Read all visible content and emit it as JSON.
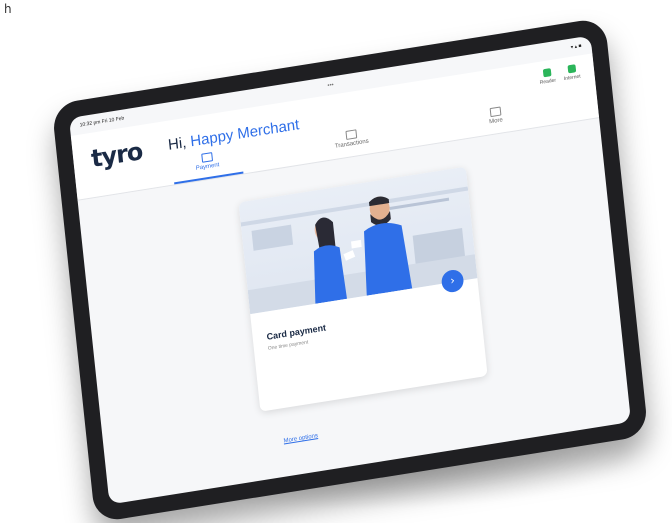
{
  "corner": {
    "text": "h"
  },
  "device": {
    "status_left": "10:32 pm  Fri 10 Feb",
    "status_right": "▾ ▴ ■"
  },
  "app": {
    "logo": "tyro",
    "greeting_prefix": "Hi, ",
    "merchant_name": "Happy Merchant",
    "indicators": [
      {
        "label": "Reader",
        "icon": "card-reader-icon"
      },
      {
        "label": "Internet",
        "icon": "wifi-icon"
      }
    ],
    "tabs": [
      {
        "label": "Payment",
        "icon": "payment-icon",
        "active": true
      },
      {
        "label": "Transactions",
        "icon": "transactions-icon",
        "active": false
      },
      {
        "label": "More",
        "icon": "more-icon",
        "active": false
      }
    ]
  },
  "card": {
    "title": "Card payment",
    "subtitle": "One time payment",
    "go_glyph": "›"
  },
  "more_options": "More options",
  "colors": {
    "accent": "#2f6fe8",
    "logo": "#1a2a45",
    "status_ok": "#2bb55a"
  }
}
